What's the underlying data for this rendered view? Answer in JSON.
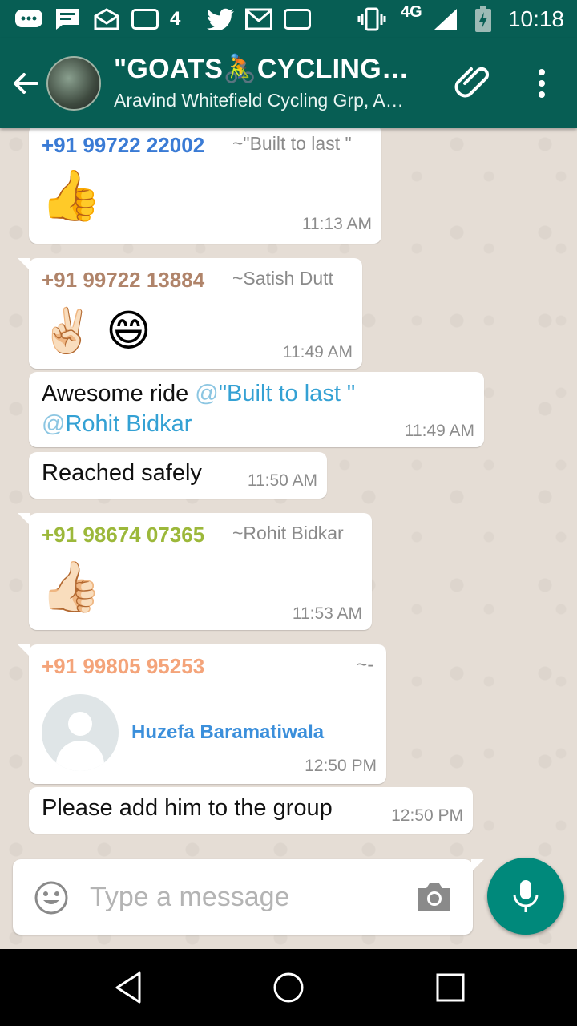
{
  "status_bar": {
    "network": "4G",
    "time": "10:18",
    "icons": [
      "messages-icon",
      "chat-icon",
      "inbox-icon",
      "app-icon",
      "channel-4-icon",
      "twitter-icon",
      "gmail-icon",
      "app-icon",
      "vibrate-icon",
      "signal-icon",
      "battery-charging-icon"
    ],
    "channel_4_label": "4"
  },
  "header": {
    "title": "\"GOATS🚴CYCLING🚴…",
    "subtitle": "Aravind Whitefield Cycling Grp, A…",
    "colors": {
      "bar": "#075e54"
    }
  },
  "messages": [
    {
      "sender": "+91 99722 22002",
      "alias": "~\"Built to last \"",
      "content": "👍",
      "time": "11:13 AM",
      "sender_color": "#3a7bd5"
    },
    {
      "sender": "+91 99722 13884",
      "alias": "~Satish Dutt",
      "content": "✌🏻 😄",
      "time": "11:49 AM",
      "sender_color": "#b0846a"
    },
    {
      "text_before": "Awesome ride ",
      "mention1_at": "@",
      "mention1": "\"Built to last \"",
      "mention2_at": "@",
      "mention2": "Rohit Bidkar",
      "time": "11:49 AM"
    },
    {
      "text": "Reached safely",
      "time": "11:50 AM"
    },
    {
      "sender": "+91 98674 07365",
      "alias": "~Rohit Bidkar",
      "content": "👍🏻",
      "time": "11:53 AM",
      "sender_color": "#9cb83a"
    },
    {
      "sender": "+91 99805 95253",
      "alias": "~-",
      "contact_name": "Huzefa Baramatiwala",
      "time": "12:50 PM",
      "sender_color": "#f4a47a"
    },
    {
      "text": "Please add him to the group",
      "time": "12:50 PM"
    }
  ],
  "input": {
    "placeholder": "Type a message"
  },
  "accent": "#00897b"
}
